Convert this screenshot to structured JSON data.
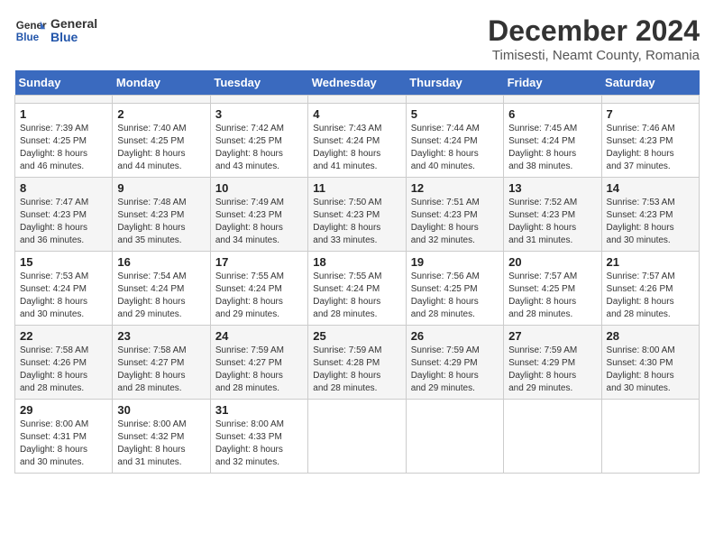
{
  "header": {
    "logo_line1": "General",
    "logo_line2": "Blue",
    "title": "December 2024",
    "subtitle": "Timisesti, Neamt County, Romania"
  },
  "calendar": {
    "days_of_week": [
      "Sunday",
      "Monday",
      "Tuesday",
      "Wednesday",
      "Thursday",
      "Friday",
      "Saturday"
    ],
    "weeks": [
      [
        {
          "day": "",
          "info": ""
        },
        {
          "day": "",
          "info": ""
        },
        {
          "day": "",
          "info": ""
        },
        {
          "day": "",
          "info": ""
        },
        {
          "day": "",
          "info": ""
        },
        {
          "day": "",
          "info": ""
        },
        {
          "day": "",
          "info": ""
        }
      ],
      [
        {
          "day": "1",
          "info": "Sunrise: 7:39 AM\nSunset: 4:25 PM\nDaylight: 8 hours\nand 46 minutes."
        },
        {
          "day": "2",
          "info": "Sunrise: 7:40 AM\nSunset: 4:25 PM\nDaylight: 8 hours\nand 44 minutes."
        },
        {
          "day": "3",
          "info": "Sunrise: 7:42 AM\nSunset: 4:25 PM\nDaylight: 8 hours\nand 43 minutes."
        },
        {
          "day": "4",
          "info": "Sunrise: 7:43 AM\nSunset: 4:24 PM\nDaylight: 8 hours\nand 41 minutes."
        },
        {
          "day": "5",
          "info": "Sunrise: 7:44 AM\nSunset: 4:24 PM\nDaylight: 8 hours\nand 40 minutes."
        },
        {
          "day": "6",
          "info": "Sunrise: 7:45 AM\nSunset: 4:24 PM\nDaylight: 8 hours\nand 38 minutes."
        },
        {
          "day": "7",
          "info": "Sunrise: 7:46 AM\nSunset: 4:23 PM\nDaylight: 8 hours\nand 37 minutes."
        }
      ],
      [
        {
          "day": "8",
          "info": "Sunrise: 7:47 AM\nSunset: 4:23 PM\nDaylight: 8 hours\nand 36 minutes."
        },
        {
          "day": "9",
          "info": "Sunrise: 7:48 AM\nSunset: 4:23 PM\nDaylight: 8 hours\nand 35 minutes."
        },
        {
          "day": "10",
          "info": "Sunrise: 7:49 AM\nSunset: 4:23 PM\nDaylight: 8 hours\nand 34 minutes."
        },
        {
          "day": "11",
          "info": "Sunrise: 7:50 AM\nSunset: 4:23 PM\nDaylight: 8 hours\nand 33 minutes."
        },
        {
          "day": "12",
          "info": "Sunrise: 7:51 AM\nSunset: 4:23 PM\nDaylight: 8 hours\nand 32 minutes."
        },
        {
          "day": "13",
          "info": "Sunrise: 7:52 AM\nSunset: 4:23 PM\nDaylight: 8 hours\nand 31 minutes."
        },
        {
          "day": "14",
          "info": "Sunrise: 7:53 AM\nSunset: 4:23 PM\nDaylight: 8 hours\nand 30 minutes."
        }
      ],
      [
        {
          "day": "15",
          "info": "Sunrise: 7:53 AM\nSunset: 4:24 PM\nDaylight: 8 hours\nand 30 minutes."
        },
        {
          "day": "16",
          "info": "Sunrise: 7:54 AM\nSunset: 4:24 PM\nDaylight: 8 hours\nand 29 minutes."
        },
        {
          "day": "17",
          "info": "Sunrise: 7:55 AM\nSunset: 4:24 PM\nDaylight: 8 hours\nand 29 minutes."
        },
        {
          "day": "18",
          "info": "Sunrise: 7:55 AM\nSunset: 4:24 PM\nDaylight: 8 hours\nand 28 minutes."
        },
        {
          "day": "19",
          "info": "Sunrise: 7:56 AM\nSunset: 4:25 PM\nDaylight: 8 hours\nand 28 minutes."
        },
        {
          "day": "20",
          "info": "Sunrise: 7:57 AM\nSunset: 4:25 PM\nDaylight: 8 hours\nand 28 minutes."
        },
        {
          "day": "21",
          "info": "Sunrise: 7:57 AM\nSunset: 4:26 PM\nDaylight: 8 hours\nand 28 minutes."
        }
      ],
      [
        {
          "day": "22",
          "info": "Sunrise: 7:58 AM\nSunset: 4:26 PM\nDaylight: 8 hours\nand 28 minutes."
        },
        {
          "day": "23",
          "info": "Sunrise: 7:58 AM\nSunset: 4:27 PM\nDaylight: 8 hours\nand 28 minutes."
        },
        {
          "day": "24",
          "info": "Sunrise: 7:59 AM\nSunset: 4:27 PM\nDaylight: 8 hours\nand 28 minutes."
        },
        {
          "day": "25",
          "info": "Sunrise: 7:59 AM\nSunset: 4:28 PM\nDaylight: 8 hours\nand 28 minutes."
        },
        {
          "day": "26",
          "info": "Sunrise: 7:59 AM\nSunset: 4:29 PM\nDaylight: 8 hours\nand 29 minutes."
        },
        {
          "day": "27",
          "info": "Sunrise: 7:59 AM\nSunset: 4:29 PM\nDaylight: 8 hours\nand 29 minutes."
        },
        {
          "day": "28",
          "info": "Sunrise: 8:00 AM\nSunset: 4:30 PM\nDaylight: 8 hours\nand 30 minutes."
        }
      ],
      [
        {
          "day": "29",
          "info": "Sunrise: 8:00 AM\nSunset: 4:31 PM\nDaylight: 8 hours\nand 30 minutes."
        },
        {
          "day": "30",
          "info": "Sunrise: 8:00 AM\nSunset: 4:32 PM\nDaylight: 8 hours\nand 31 minutes."
        },
        {
          "day": "31",
          "info": "Sunrise: 8:00 AM\nSunset: 4:33 PM\nDaylight: 8 hours\nand 32 minutes."
        },
        {
          "day": "",
          "info": ""
        },
        {
          "day": "",
          "info": ""
        },
        {
          "day": "",
          "info": ""
        },
        {
          "day": "",
          "info": ""
        }
      ]
    ]
  }
}
